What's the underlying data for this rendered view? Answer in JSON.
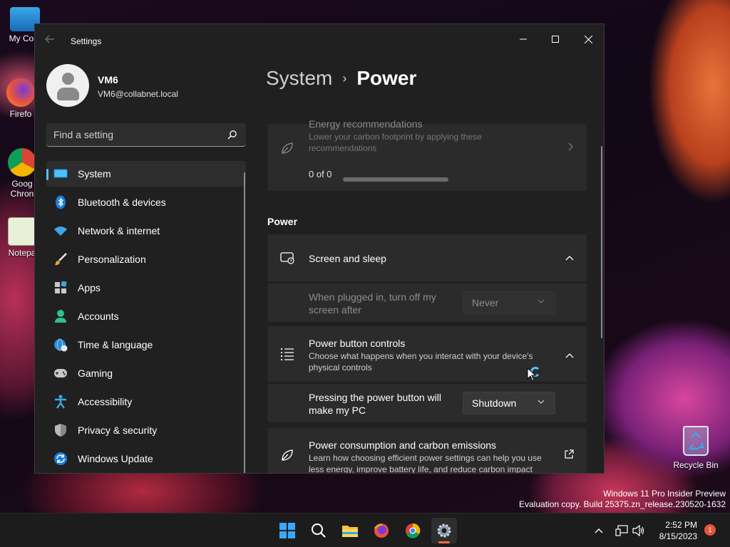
{
  "desktop": {
    "icons": [
      {
        "label": "My Com"
      },
      {
        "label": "Firefo"
      },
      {
        "label": "Goog"
      },
      {
        "label": "Chron"
      },
      {
        "label": "Notepa"
      }
    ],
    "recycle_bin": "Recycle Bin",
    "watermark_line1": "Windows 11 Pro Insider Preview",
    "watermark_line2": "Evaluation copy. Build 25375.zn_release.230520-1632"
  },
  "window": {
    "title": "Settings",
    "minimize": "–",
    "maximize": "☐",
    "close": "✕"
  },
  "profile": {
    "name": "VM6",
    "email": "VM6@collabnet.local"
  },
  "search": {
    "placeholder": "Find a setting"
  },
  "nav": {
    "items": [
      {
        "label": "System",
        "icon": "monitor-icon",
        "active": true
      },
      {
        "label": "Bluetooth & devices",
        "icon": "bluetooth-icon"
      },
      {
        "label": "Network & internet",
        "icon": "wifi-icon"
      },
      {
        "label": "Personalization",
        "icon": "brush-icon"
      },
      {
        "label": "Apps",
        "icon": "apps-icon"
      },
      {
        "label": "Accounts",
        "icon": "person-icon"
      },
      {
        "label": "Time & language",
        "icon": "globe-clock-icon"
      },
      {
        "label": "Gaming",
        "icon": "gamepad-icon"
      },
      {
        "label": "Accessibility",
        "icon": "accessibility-icon"
      },
      {
        "label": "Privacy & security",
        "icon": "shield-icon"
      },
      {
        "label": "Windows Update",
        "icon": "update-icon"
      }
    ]
  },
  "main": {
    "breadcrumb_parent": "System",
    "breadcrumb_sep": "›",
    "breadcrumb_current": "Power",
    "energy": {
      "title": "Energy recommendations",
      "desc_line1": "Lower your carbon footprint by applying these",
      "desc_line2": "recommendations",
      "progress_text": "0 of 0",
      "progress_value": 0
    },
    "section_power": "Power",
    "screen_sleep": {
      "title": "Screen and sleep",
      "row_label_line1": "When plugged in, turn off my",
      "row_label_line2": "screen after",
      "value": "Never"
    },
    "power_button": {
      "title": "Power button controls",
      "desc_line1": "Choose what happens when you interact with your device's",
      "desc_line2": "physical controls",
      "row_label_line1": "Pressing the power button will",
      "row_label_line2": "make my PC",
      "value": "Shutdown"
    },
    "consumption": {
      "title": "Power consumption and carbon emissions",
      "desc_line1": "Learn how choosing efficient power settings can help you use",
      "desc_line2": "less energy, improve battery life, and reduce carbon impact"
    }
  },
  "taskbar": {
    "time": "2:52 PM",
    "date": "8/15/2023",
    "notifications": "1"
  },
  "colors": {
    "accent": "#4cc2ff",
    "window_bg": "#202020",
    "card_bg": "#2b2b2b"
  }
}
